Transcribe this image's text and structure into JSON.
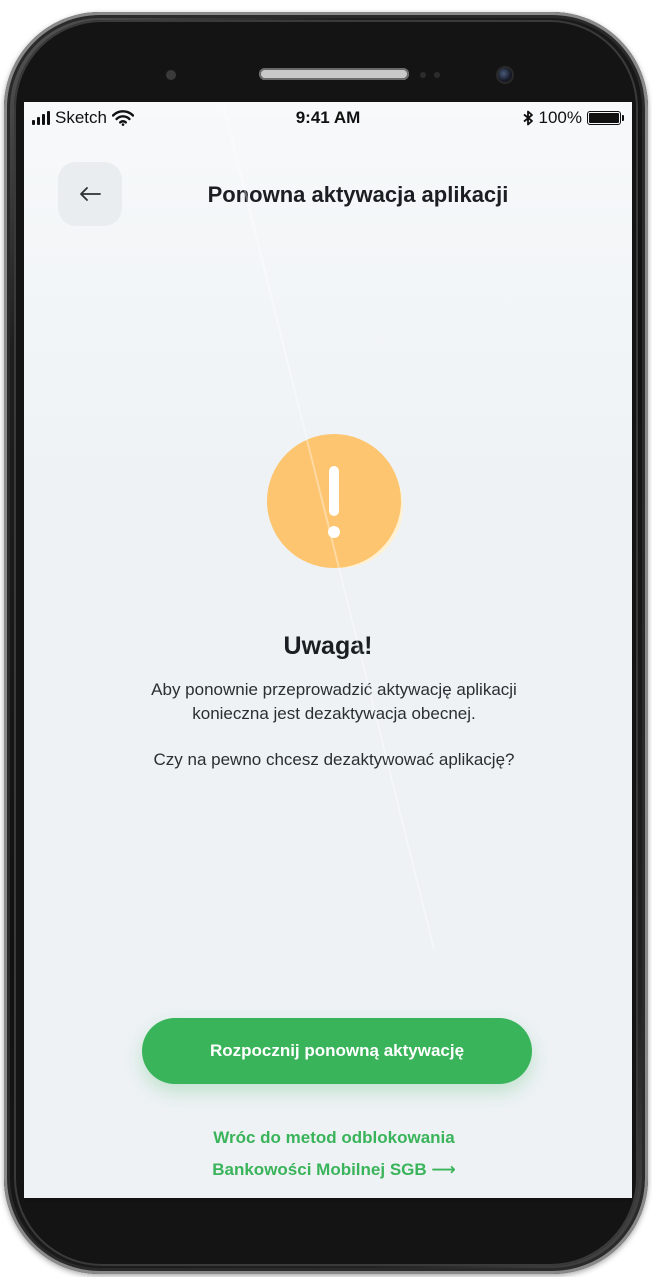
{
  "status_bar": {
    "carrier": "Sketch",
    "time": "9:41 AM",
    "battery_percent_label": "100%",
    "battery_level": 1.0,
    "wifi_icon": "wifi-icon",
    "bluetooth_icon": "bluetooth-icon"
  },
  "header": {
    "title": "Ponowna aktywacja aplikacji",
    "back_icon": "arrow-left-icon"
  },
  "alert": {
    "icon": "exclamation-icon",
    "icon_color": "#fdc56f",
    "title": "Uwaga!",
    "message_line1": "Aby ponownie przeprowadzić aktywację aplikacji",
    "message_line2": "konieczna jest dezaktywacja obecnej.",
    "question": "Czy na pewno chcesz dezaktywować aplikację?"
  },
  "actions": {
    "primary_label": "Rozpocznij ponowną aktywację",
    "primary_color": "#3ab45a",
    "link_line1": "Wróc do metod odblokowania",
    "link_line2": "Bankowości Mobilnej SGB",
    "link_arrow": "⟶"
  }
}
